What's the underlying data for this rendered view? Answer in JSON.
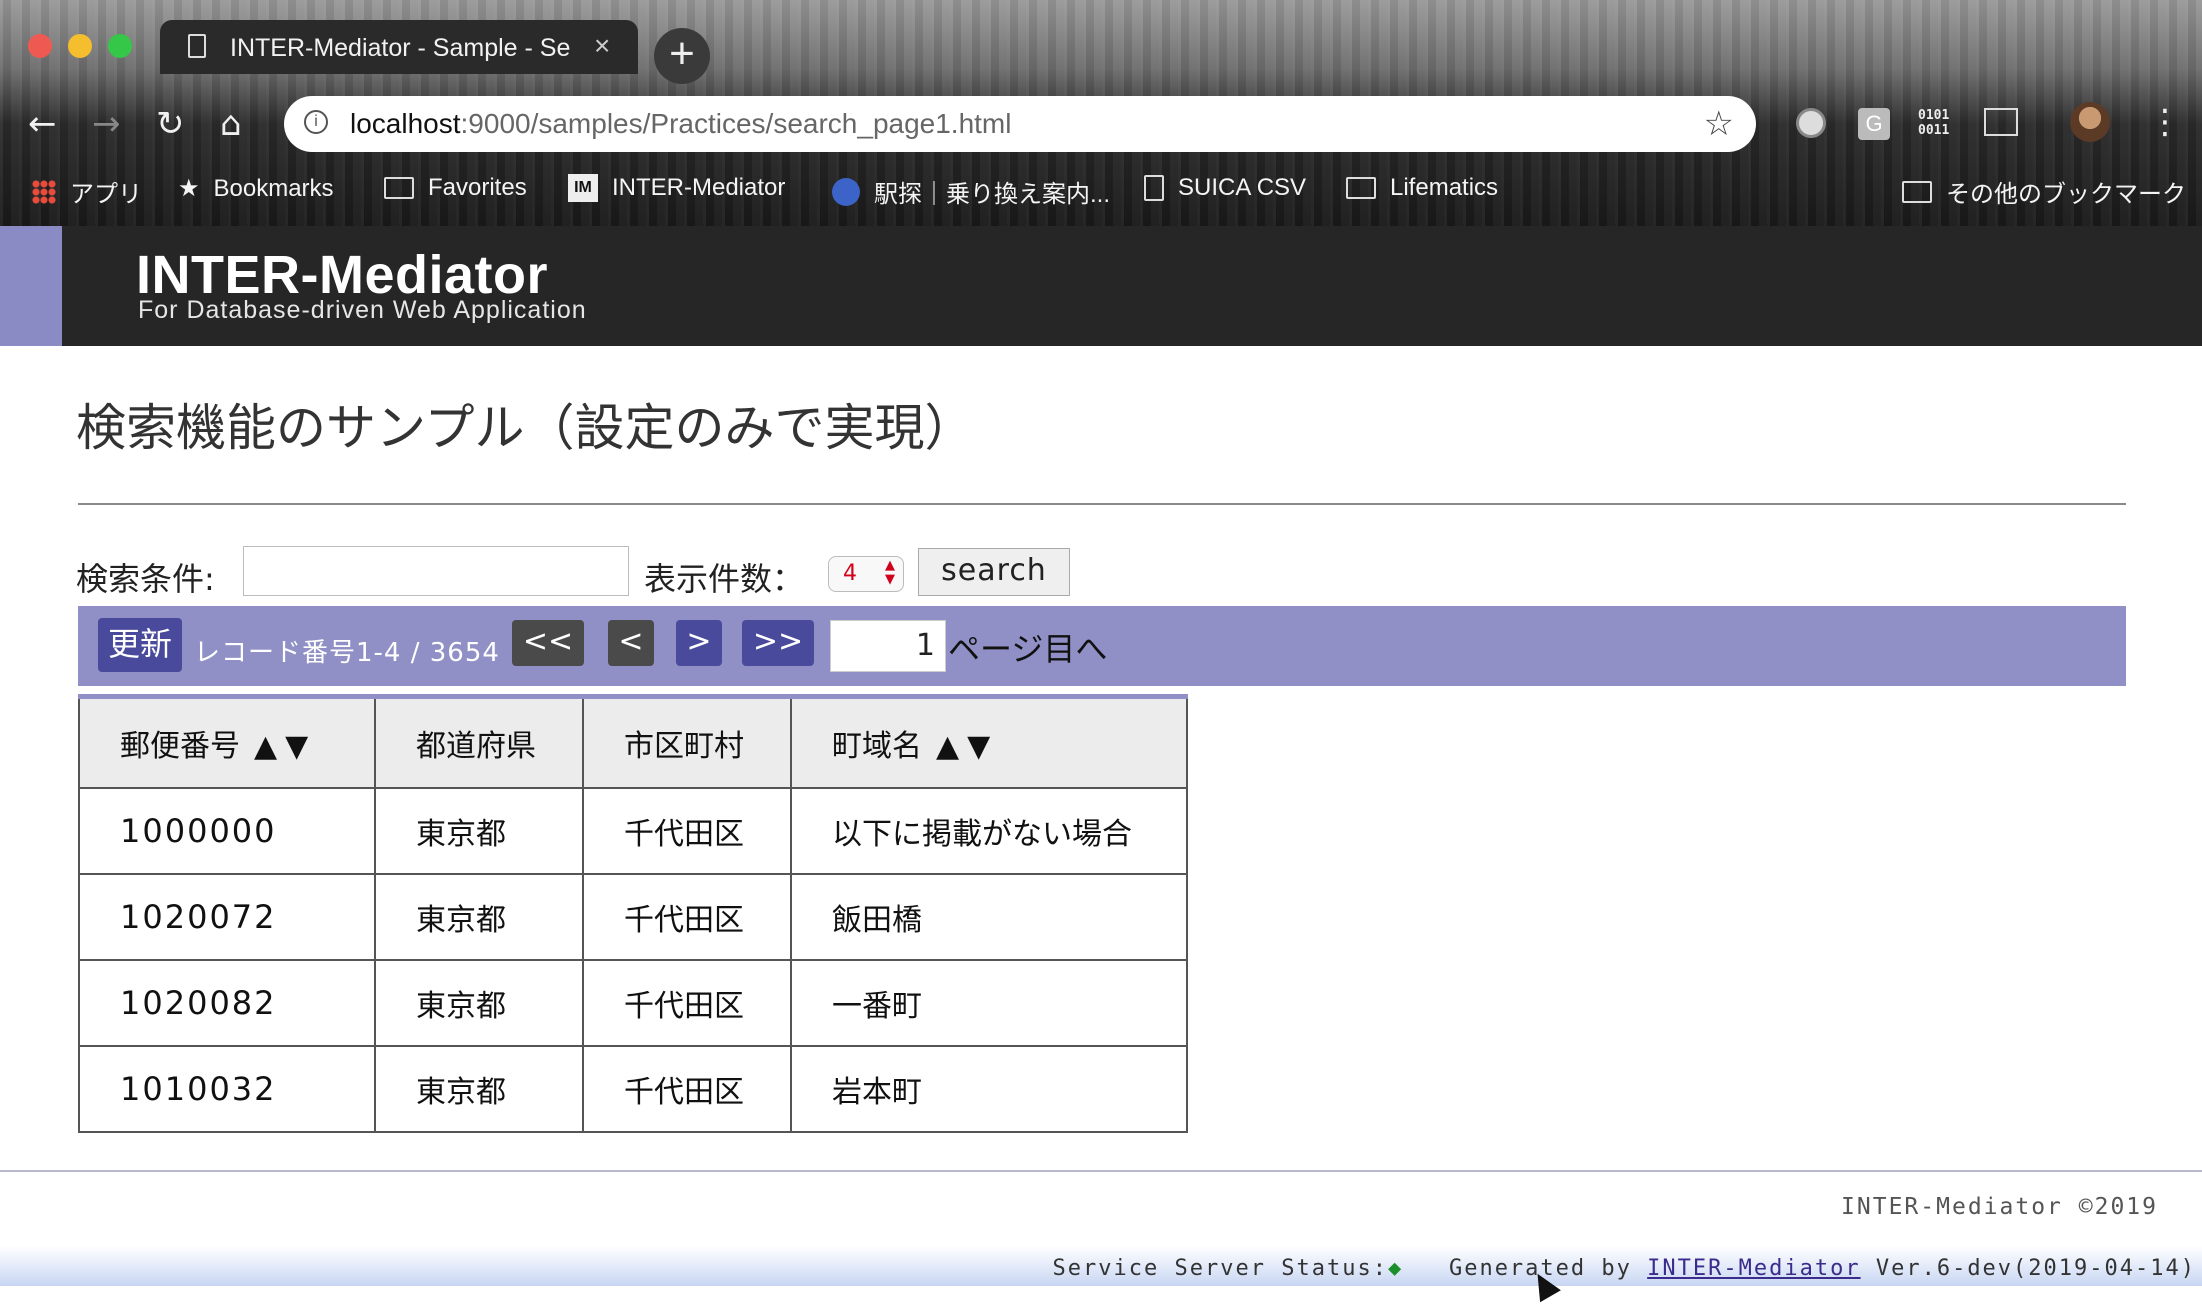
{
  "browser": {
    "tab_title": "INTER-Mediator - Sample - Se",
    "tab_close": "×",
    "new_tab": "+",
    "url_host": "localhost",
    "url_path": ":9000/samples/Practices/search_page1.html",
    "nav": {
      "back": "←",
      "forward": "→",
      "reload": "↻",
      "home": "⌂",
      "star": "☆",
      "info": "i",
      "menu": "⋮"
    },
    "ext_g": "G",
    "ext_bin": "0101\n0011"
  },
  "bookmarks": {
    "items": [
      {
        "label": "アプリ",
        "icon": "apps-grid-icon"
      },
      {
        "label": "Bookmarks",
        "icon": "star-icon"
      },
      {
        "label": "Favorites",
        "icon": "folder-icon"
      },
      {
        "label": "INTER-Mediator",
        "icon": "im-logo-icon"
      },
      {
        "label": "駅探｜乗り換え案内...",
        "icon": "ekitan-icon"
      },
      {
        "label": "SUICA CSV",
        "icon": "file-icon"
      },
      {
        "label": "Lifematics",
        "icon": "folder-icon"
      }
    ],
    "other": "その他のブックマーク",
    "im_icon_text": "IM",
    "star_glyph": "★"
  },
  "header": {
    "logo_title": "INTER-Mediator",
    "logo_subtitle": "For Database-driven Web Application",
    "accent_color": "#8a8ac4"
  },
  "page": {
    "title": "検索機能のサンプル（設定のみで実現）"
  },
  "search": {
    "condition_label": "検索条件:",
    "condition_value": "",
    "count_label": "表示件数：",
    "count_value": "4",
    "button_label": "search"
  },
  "navigation": {
    "refresh_label": "更新",
    "record_info": "レコード番号1-4 / 3654",
    "first_label": "<<",
    "prev_label": "<",
    "next_label": ">",
    "last_label": ">>",
    "page_value": "1",
    "page_suffix": "ページ目へ",
    "bar_color": "#9090c6"
  },
  "table": {
    "headers": [
      "郵便番号",
      "都道府県",
      "市区町村",
      "町域名"
    ],
    "sort_arrows": "▲▼",
    "rows": [
      {
        "zip": "1000000",
        "pref": "東京都",
        "city": "千代田区",
        "town": "以下に掲載がない場合"
      },
      {
        "zip": "1020072",
        "pref": "東京都",
        "city": "千代田区",
        "town": "飯田橋"
      },
      {
        "zip": "1020082",
        "pref": "東京都",
        "city": "千代田区",
        "town": "一番町"
      },
      {
        "zip": "1010032",
        "pref": "東京都",
        "city": "千代田区",
        "town": "岩本町"
      }
    ]
  },
  "footer": {
    "copyright": "INTER-Mediator ©2019",
    "status_label": "Service Server Status:",
    "status_indicator": "◆",
    "generated_by": "Generated by",
    "generated_link": "INTER-Mediator",
    "version": "Ver.6-dev(2019-04-14)"
  }
}
